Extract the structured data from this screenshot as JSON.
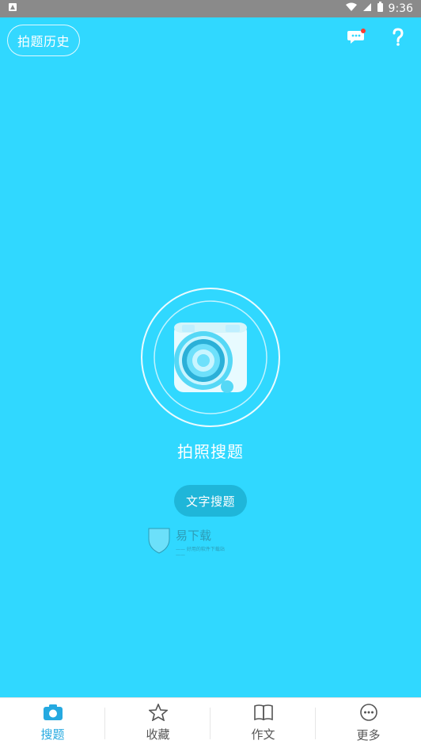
{
  "statusbar": {
    "time": "9:36"
  },
  "header": {
    "history_label": "拍题历史"
  },
  "center": {
    "photo_search_label": "拍照搜题",
    "text_search_label": "文字搜题"
  },
  "watermark": {
    "title": "易下载",
    "subtitle": "—— 好用的软件下载站 ——"
  },
  "bottom_nav": {
    "items": [
      {
        "label": "搜题",
        "icon": "camera-icon",
        "active": true
      },
      {
        "label": "收藏",
        "icon": "star-icon",
        "active": false
      },
      {
        "label": "作文",
        "icon": "book-icon",
        "active": false
      },
      {
        "label": "更多",
        "icon": "more-icon",
        "active": false
      }
    ]
  },
  "colors": {
    "main_bg": "#30d8ff",
    "active_nav": "#25a9e0",
    "text_button_bg": "#1fb6d9",
    "notification_dot": "#ff3b30"
  }
}
